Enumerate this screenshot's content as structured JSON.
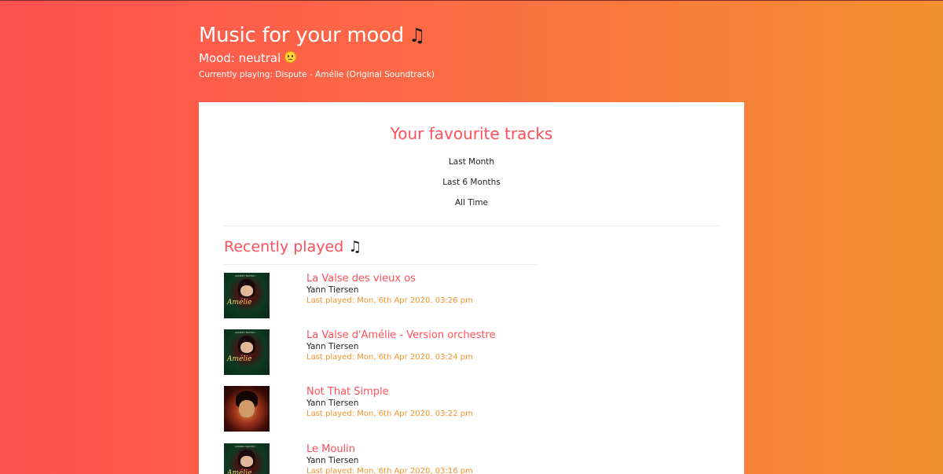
{
  "header": {
    "title": "Music for your mood",
    "title_icon": "music-note-icon",
    "mood_label": "Mood: neutral",
    "mood_icon": "neutral-face-icon",
    "currently_playing": "Currently playing: Dispute - Amélie (Original Soundtrack)"
  },
  "favourites": {
    "title": "Your favourite tracks",
    "ranges": [
      "Last Month",
      "Last 6 Months",
      "All Time"
    ]
  },
  "recent": {
    "title": "Recently played",
    "title_icon": "music-note-icon",
    "tracks": [
      {
        "name": "La Valse des vieux os",
        "artist": "Yann Tiersen",
        "last_played": "Last played: Mon, 6th Apr 2020, 03:26 pm",
        "cover": "amelie"
      },
      {
        "name": "La Valse d'Amélie - Version orchestre",
        "artist": "Yann Tiersen",
        "last_played": "Last played: Mon, 6th Apr 2020, 03:24 pm",
        "cover": "amelie"
      },
      {
        "name": "Not That Simple",
        "artist": "Yann Tiersen",
        "last_played": "Last played: Mon, 6th Apr 2020, 03:22 pm",
        "cover": "simple"
      },
      {
        "name": "Le Moulin",
        "artist": "Yann Tiersen",
        "last_played": "Last played: Mon, 6th Apr 2020, 03:16 pm",
        "cover": "amelie"
      }
    ]
  },
  "colors": {
    "accent": "#ff4f5a",
    "timestamp": "#f0932b",
    "gradient_start": "#ff5050",
    "gradient_end": "#f2902f"
  }
}
